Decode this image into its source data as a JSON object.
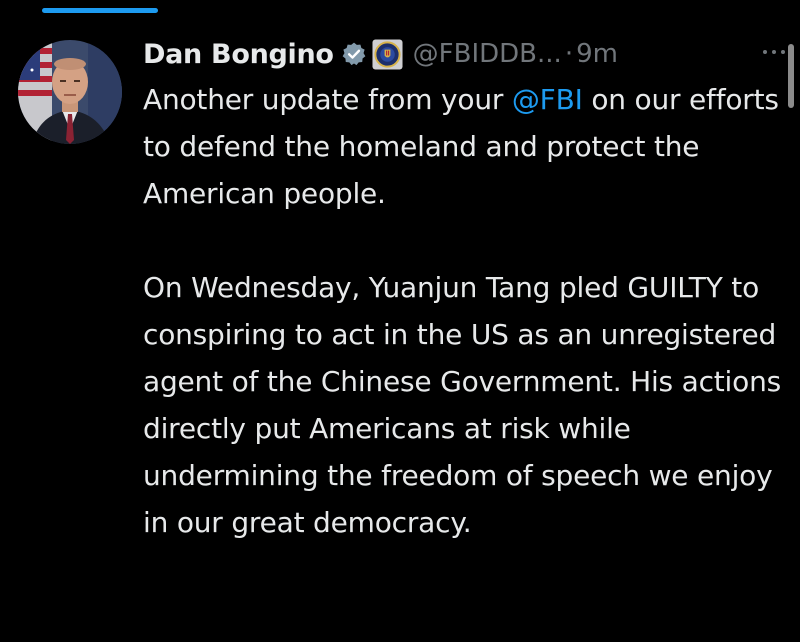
{
  "colors": {
    "background": "#000000",
    "text": "#e7e9ea",
    "secondary": "#71767b",
    "accent": "#1d9bf0"
  },
  "tweet": {
    "author": {
      "display_name": "Dan Bongino",
      "handle": "@FBIDDB...",
      "verified_icon": "verified-badge-icon",
      "affiliate_icon": "fbi-seal-icon"
    },
    "separator": "·",
    "timestamp": "9m",
    "more_icon": "more-options-icon",
    "paragraph1": {
      "before": "Another update from your ",
      "mention": "@FBI",
      "after": " on our efforts to defend the homeland and protect the American people."
    },
    "paragraph2": "On Wednesday, Yuanjun Tang pled GUILTY to conspiring to act in the US as an unregistered agent of the Chinese Government. His actions directly put Americans at risk while undermining the freedom of speech we enjoy in our great democracy."
  }
}
